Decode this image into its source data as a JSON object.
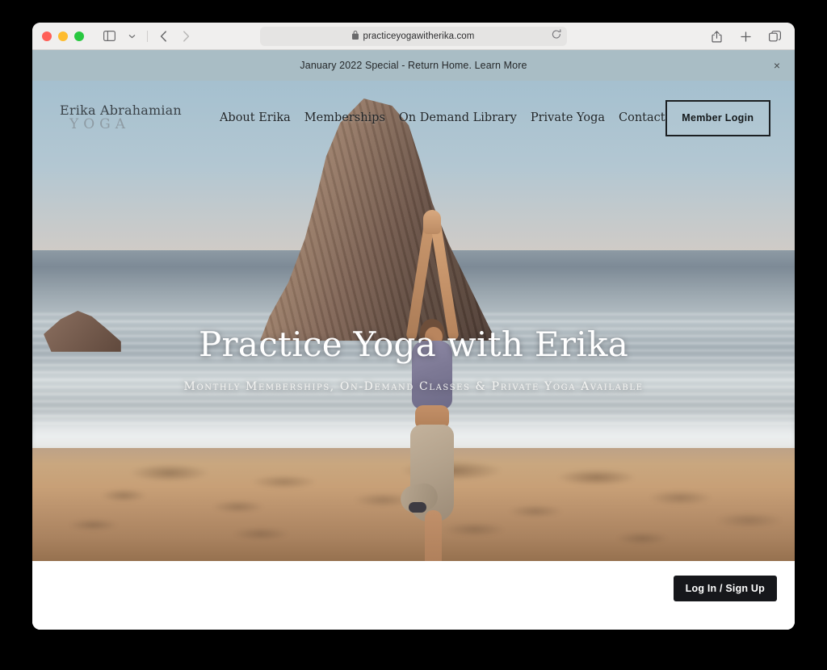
{
  "browser": {
    "url": "practiceyogawitherika.com",
    "icons": {
      "sidebar": "sidebar-toggle-icon",
      "tab_overview": "chevron-down-icon",
      "back": "back-arrow-icon",
      "forward": "forward-arrow-icon",
      "lock": "lock-icon",
      "reload": "reload-icon",
      "share": "share-icon",
      "new_tab": "plus-icon",
      "tabs": "tabs-icon"
    },
    "traffic_lights": {
      "close": "#ff5f57",
      "minimize": "#febc2e",
      "maximize": "#28c840"
    }
  },
  "announcement": {
    "text": "January 2022 Special - Return Home. Learn More",
    "close_label": "×",
    "background": "#a9bdc5"
  },
  "site_header": {
    "logo": {
      "name": "Erika Abrahamian",
      "subtitle": "YOGA"
    },
    "nav": [
      {
        "label": "About Erika"
      },
      {
        "label": "Memberships"
      },
      {
        "label": "On Demand Library"
      },
      {
        "label": "Private Yoga"
      },
      {
        "label": "Contact"
      }
    ],
    "member_login_label": "Member Login"
  },
  "hero": {
    "title": "Practice Yoga with Erika",
    "subtitle": "Monthly Memberships, On-Demand Classes & Private Yoga Available",
    "image_description": "Woman practicing tree pose on a sunset beach with a large sea stack rock and ocean waves",
    "colors": {
      "sky_top": "#a5c0cf",
      "sky_horizon": "#e2cfbe",
      "sand": "#c8a077",
      "rock": "#7a5f51"
    }
  },
  "footer": {
    "login_signup_label": "Log In / Sign Up",
    "background": "#ffffff",
    "button_background": "#16171b"
  }
}
